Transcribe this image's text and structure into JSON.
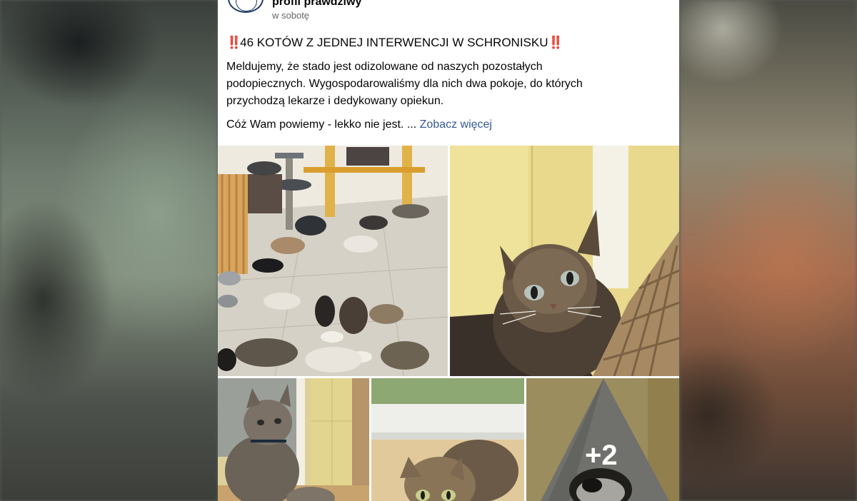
{
  "post": {
    "author": "profil prawdziwy",
    "timestamp": "w sobotę",
    "headline_emoji": "‼️",
    "headline": "46 KOTÓW Z JEDNEJ INTERWENCJI W SCHRONISKU",
    "body": "Meldujemy, że stado jest odizolowane od naszych pozostałych podopiecznych. Wygospodarowaliśmy dla nich dwa pokoje, do których przychodzą lekarze i dedykowany opiekun.",
    "body_line1": "Meldujemy, że stado jest odizolowane od naszych pozostałych",
    "body_line2": "podopiecznych. Wygospodarowaliśmy dla nich dwa pokoje, do których",
    "body_line3": "przychodzą lekarze i dedykowany opiekun.",
    "teaser": "Cóż Wam powiemy - lekko nie jest. ...",
    "see_more": "Zobacz więcej"
  },
  "gallery": {
    "more_count": "+2"
  },
  "colors": {
    "link": "#385898",
    "emoji": "#e0245e",
    "text": "#050505",
    "meta": "#65676b"
  }
}
